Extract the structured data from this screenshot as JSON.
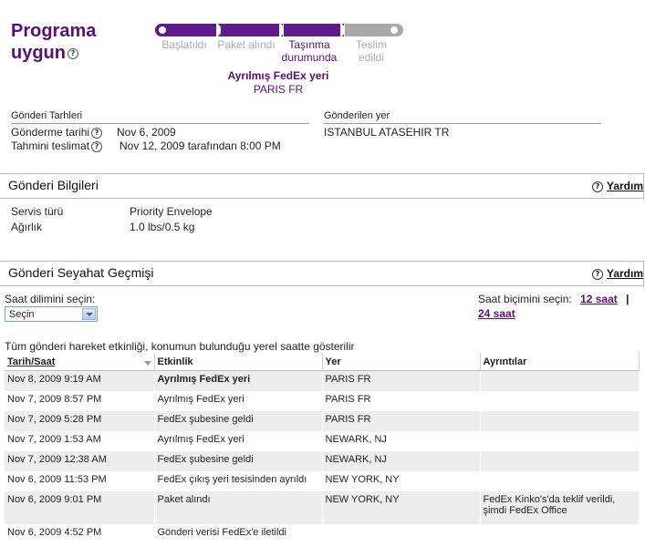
{
  "status": {
    "title_line1": "Programa",
    "title_line2": "uygun",
    "help_glyph": "?",
    "steps": [
      {
        "label1": "Başlatıldı",
        "label2": "",
        "state": "done"
      },
      {
        "label1": "Paket alındı",
        "label2": "",
        "state": "done"
      },
      {
        "label1": "Taşınma",
        "label2": "durumunda",
        "state": "current"
      },
      {
        "label1": "Teslim",
        "label2": "edildi",
        "state": "pending"
      }
    ],
    "progress_completed_steps": 3,
    "progress_total_steps": 4,
    "current_event": "Ayrılmış FedEx yeri",
    "current_location": "PARIS FR",
    "accent_color": "#5a0e78",
    "pending_color": "#a9a9a9"
  },
  "dates": {
    "section_label": "Gönderi Tarhleri",
    "ship_label": "Gönderme tarihi",
    "ship_value": "Nov 6, 2009",
    "eta_label": "Tahmini teslimat",
    "eta_value": "Nov 12, 2009 tarafından 8:00 PM"
  },
  "destination": {
    "section_label": "Gönderilen yer",
    "value": "ISTANBUL ATASEHIR TR"
  },
  "shipment_info": {
    "title": "Gönderi Bilgileri",
    "help_label": "Yardım",
    "service_label": "Servis türü",
    "service_value": "Priority Envelope",
    "weight_label": "Ağırlık",
    "weight_value": "1.0 lbs/0.5 kg"
  },
  "travel_history": {
    "title": "Gönderi Seyahat Geçmişi",
    "help_label": "Yardım",
    "timezone_label": "Saat dilimini seçin:",
    "timezone_selected": "Seçin",
    "format_label": "Saat biçimini seçin:",
    "format_12": "12 saat",
    "format_separator": "|",
    "format_24": "24 saat",
    "note": "Tüm gönderi hareket etkinliği, konumun bulunduğu yerel saatte gösterilir",
    "columns": [
      "Tarih/Saat",
      "Etkinlik",
      "Yer",
      "Ayrıntılar"
    ],
    "rows": [
      {
        "datetime": "Nov 8, 2009 9:19 AM",
        "activity": "Ayrılmış FedEx yeri",
        "location": "PARIS FR",
        "details": "",
        "bold": true
      },
      {
        "datetime": "Nov 7, 2009 8:57 PM",
        "activity": "Ayrılmış FedEx yeri",
        "location": "PARIS FR",
        "details": ""
      },
      {
        "datetime": "Nov 7, 2009 5:28 PM",
        "activity": "FedEx şubesine geldi",
        "location": "PARIS FR",
        "details": ""
      },
      {
        "datetime": "Nov 7, 2009 1:53 AM",
        "activity": "Ayrılmış FedEx yeri",
        "location": "NEWARK, NJ",
        "details": ""
      },
      {
        "datetime": "Nov 7, 2009 12:38 AM",
        "activity": "FedEx şubesine geldi",
        "location": "NEWARK, NJ",
        "details": ""
      },
      {
        "datetime": "Nov 6, 2009 11:53 PM",
        "activity": "FedEx çıkış yeri tesisinden ayrıldı",
        "location": "NEW YORK, NY",
        "details": ""
      },
      {
        "datetime": "Nov 6, 2009 9:01 PM",
        "activity": "Paket alındı",
        "location": "NEW YORK, NY",
        "details": "FedEx Kinko's'da teklif verildi, şimdi FedEx Office"
      },
      {
        "datetime": "Nov 6, 2009 4:52 PM",
        "activity": "Gönderi verisi FedEx'e iletildi",
        "location": "",
        "details": ""
      }
    ]
  }
}
